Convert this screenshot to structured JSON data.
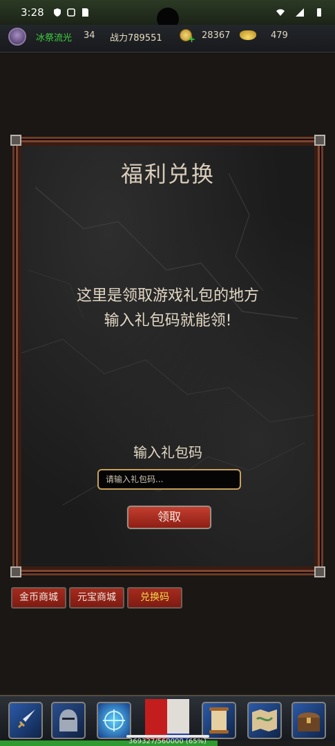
{
  "status_bar": {
    "time": "3:28"
  },
  "header": {
    "player_name": "冰祭流光",
    "level": "34",
    "power": "战力789551",
    "coins": "28367",
    "ingots": "479"
  },
  "panel": {
    "title": "福利兑换",
    "description_line1": "这里是领取游戏礼包的地方",
    "description_line2": "输入礼包码就能领!",
    "input_label": "输入礼包码",
    "input_placeholder": "请输入礼包码...",
    "input_value": "",
    "claim_button": "领取"
  },
  "tabs": [
    {
      "label": "金币商城",
      "active": false
    },
    {
      "label": "元宝商城",
      "active": false
    },
    {
      "label": "兑换码",
      "active": true
    }
  ],
  "bottom_nav": {
    "items": [
      {
        "icon": "sword-icon",
        "glyph": "🗡"
      },
      {
        "icon": "knight-helmet-icon",
        "glyph": "⛨"
      },
      {
        "icon": "magic-compass-icon",
        "glyph": "✵"
      },
      {
        "icon": "scroll-icon",
        "glyph": "📜"
      },
      {
        "icon": "map-icon",
        "glyph": "🗺"
      },
      {
        "icon": "treasure-chest-icon",
        "glyph": "🧰"
      }
    ]
  },
  "exp": {
    "current": 369327,
    "max": 560000,
    "text": "369327/560000 (65%)",
    "fraction": 0.65
  },
  "colors": {
    "accent_red": "#a62a1d",
    "active_tab_text": "#f5d84a",
    "player_name": "#3ed23e"
  }
}
